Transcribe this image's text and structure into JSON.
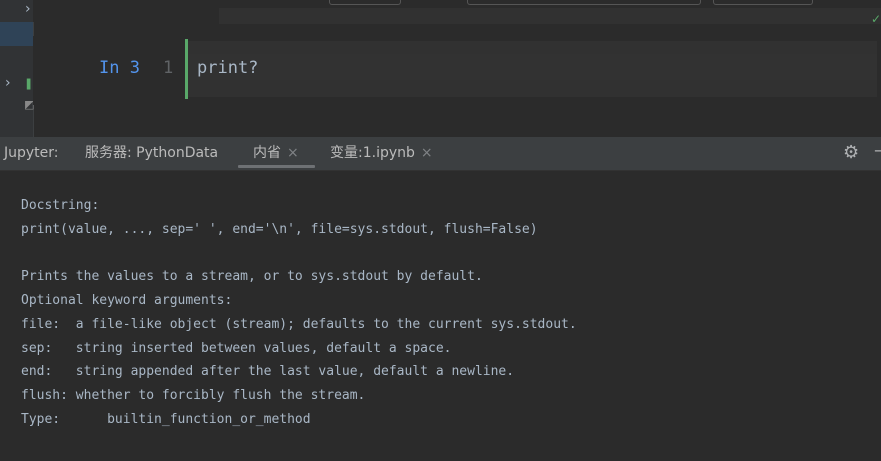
{
  "editor": {
    "cell": {
      "prompt": "In 3",
      "line_number": "1",
      "code": "print?"
    }
  },
  "gutter": {
    "chevron_icon": "chevron-right",
    "mark_icon": "run-marker"
  },
  "tool_window": {
    "tabs": [
      {
        "label": "Jupyter:"
      },
      {
        "label": "服务器: PythonData"
      },
      {
        "label": "内省",
        "close": "×",
        "active": true
      },
      {
        "label": "变量:1.ipynb",
        "close": "×"
      }
    ],
    "settings_icon": "gear-icon",
    "minimize_icon": "minus-icon"
  },
  "doc": {
    "lines": [
      "Docstring:",
      "print(value, ..., sep=' ', end='\\n', file=sys.stdout, flush=False)",
      "",
      "Prints the values to a stream, or to sys.stdout by default.",
      "Optional keyword arguments:",
      "file:  a file-like object (stream); defaults to the current sys.stdout.",
      "sep:   string inserted between values, default a space.",
      "end:   string appended after the last value, default a newline.",
      "flush: whether to forcibly flush the stream.",
      "Type:      builtin_function_or_method"
    ]
  },
  "colors": {
    "background": "#2b2b2b",
    "prompt": "#5394ec",
    "cell_marker": "#59a869",
    "text": "#a9b7c6"
  }
}
